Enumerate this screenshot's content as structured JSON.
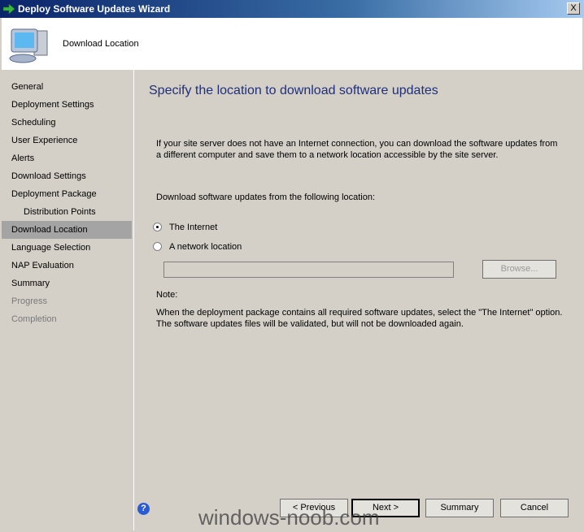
{
  "window": {
    "title": "Deploy Software Updates Wizard",
    "close_label": "X"
  },
  "header": {
    "title": "Download Location"
  },
  "nav": {
    "items": [
      {
        "label": "General",
        "state": "normal"
      },
      {
        "label": "Deployment Settings",
        "state": "normal"
      },
      {
        "label": "Scheduling",
        "state": "normal"
      },
      {
        "label": "User Experience",
        "state": "normal"
      },
      {
        "label": "Alerts",
        "state": "normal"
      },
      {
        "label": "Download Settings",
        "state": "normal"
      },
      {
        "label": "Deployment Package",
        "state": "normal"
      },
      {
        "label": "Distribution Points",
        "state": "sub"
      },
      {
        "label": "Download Location",
        "state": "selected"
      },
      {
        "label": "Language Selection",
        "state": "normal"
      },
      {
        "label": "NAP Evaluation",
        "state": "normal"
      },
      {
        "label": "Summary",
        "state": "normal"
      },
      {
        "label": "Progress",
        "state": "disabled"
      },
      {
        "label": "Completion",
        "state": "disabled"
      }
    ]
  },
  "main": {
    "heading": "Specify the location to download software updates",
    "intro": "If your site server does not have an Internet connection, you can download the software updates from a different computer and save them to a network location accessible by the site server.",
    "prompt": "Download software updates from the following location:",
    "option_internet": "The Internet",
    "option_network": "A network location",
    "network_path_value": "",
    "browse_label": "Browse...",
    "note_label": "Note:",
    "note_text": "When the deployment package contains all required software updates, select the \"The Internet\" option. The software updates files will be validated, but will not be downloaded again.",
    "selected_option": "The Internet"
  },
  "footer": {
    "previous": "< Previous",
    "next": "Next >",
    "summary": "Summary",
    "cancel": "Cancel"
  },
  "watermark": "windows-noob.com"
}
